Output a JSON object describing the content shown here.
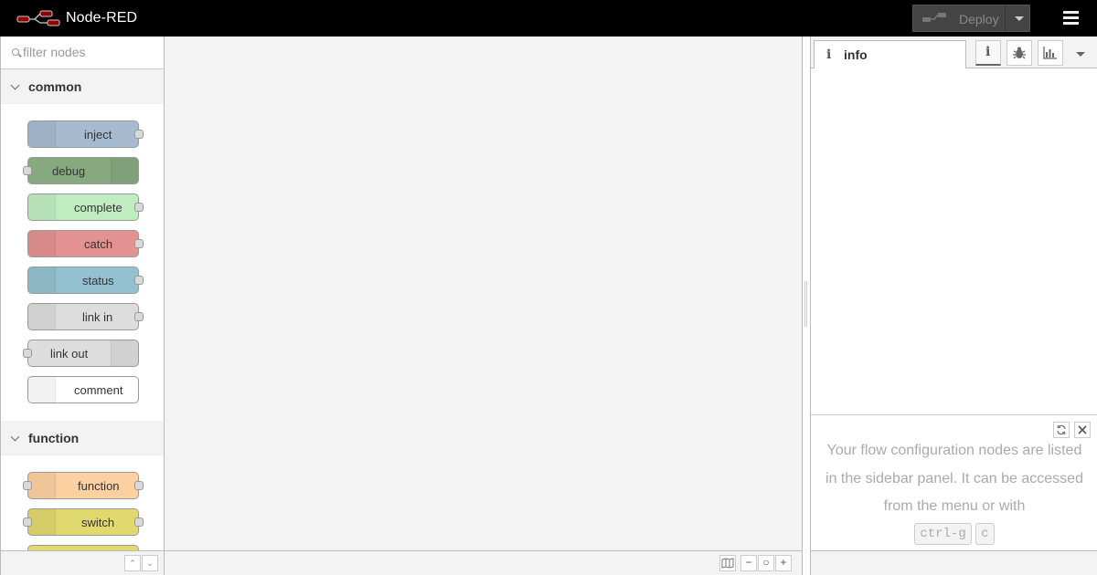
{
  "header": {
    "app_title": "Node-RED",
    "deploy_label": "Deploy"
  },
  "palette": {
    "filter_placeholder": "filter nodes",
    "categories": [
      {
        "label": "common",
        "nodes": [
          {
            "label": "inject",
            "color": "#a6bbcf"
          },
          {
            "label": "debug",
            "color": "#87a980"
          },
          {
            "label": "complete",
            "color": "#c0edc0"
          },
          {
            "label": "catch",
            "color": "#e49191"
          },
          {
            "label": "status",
            "color": "#94c1d0"
          },
          {
            "label": "link in",
            "color": "#dddddd"
          },
          {
            "label": "link out",
            "color": "#dddddd"
          },
          {
            "label": "comment",
            "color": "#ffffff"
          }
        ]
      },
      {
        "label": "function",
        "nodes": [
          {
            "label": "function",
            "color": "#fdd0a2"
          },
          {
            "label": "switch",
            "color": "#e2d96e"
          }
        ]
      }
    ]
  },
  "sidebar": {
    "active_tab": "info",
    "tip": {
      "text": "Your flow configuration nodes are listed in the sidebar panel. It can be accessed from the menu or with",
      "key1": "ctrl-g",
      "key2": "c"
    }
  }
}
